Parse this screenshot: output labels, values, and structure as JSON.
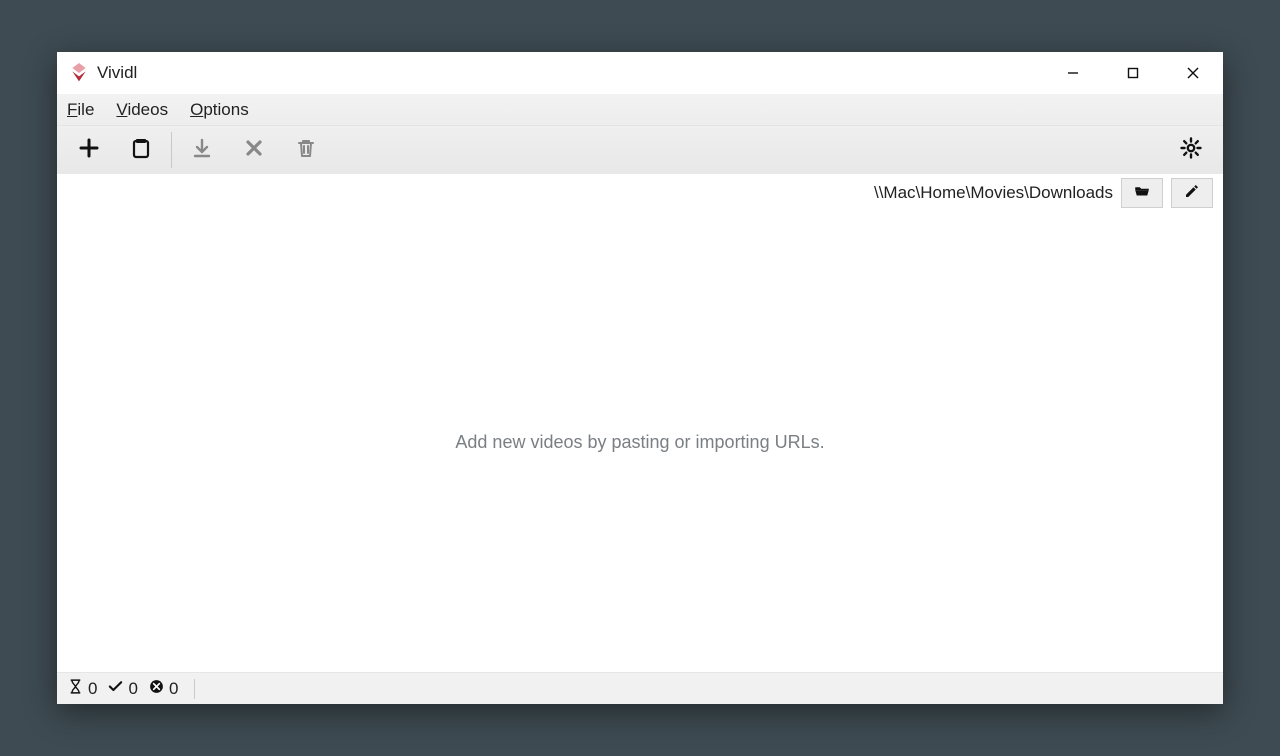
{
  "window": {
    "title": "Vividl"
  },
  "menubar": {
    "file": "File",
    "videos": "Videos",
    "options": "Options"
  },
  "pathbar": {
    "path": "\\\\Mac\\Home\\Movies\\Downloads"
  },
  "content": {
    "empty_message": "Add new videos by pasting or importing URLs."
  },
  "statusbar": {
    "pending_count": "0",
    "done_count": "0",
    "error_count": "0"
  }
}
